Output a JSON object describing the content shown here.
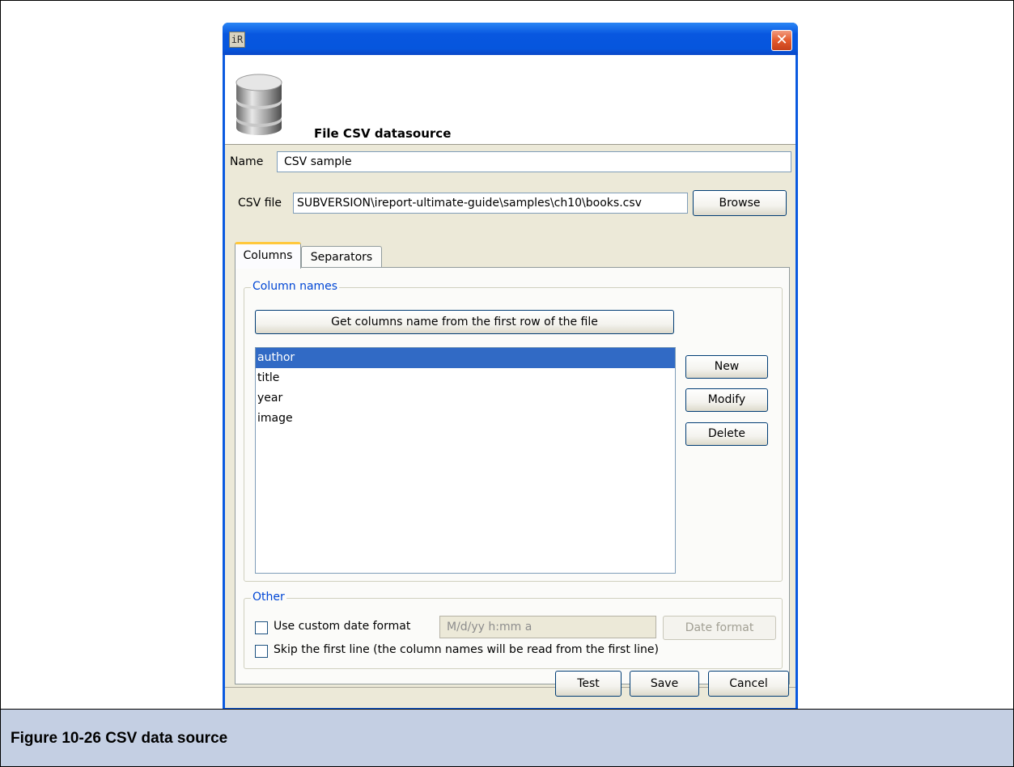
{
  "dialog": {
    "header_title": "File CSV datasource",
    "close_glyph": "✕",
    "app_icon": "iR"
  },
  "name_field": {
    "label": "Name",
    "value": "CSV sample"
  },
  "csv_file": {
    "label": "CSV file",
    "value": "SUBVERSION\\ireport-ultimate-guide\\samples\\ch10\\books.csv",
    "browse_label": "Browse"
  },
  "tabs": [
    {
      "label": "Columns",
      "active": true
    },
    {
      "label": "Separators",
      "active": false
    }
  ],
  "columns_group": {
    "legend": "Column names",
    "get_columns_label": "Get columns name from the first row of the file",
    "items": [
      "author",
      "title",
      "year",
      "image"
    ],
    "selected_index": 0,
    "new_label": "New",
    "modify_label": "Modify",
    "delete_label": "Delete"
  },
  "other_group": {
    "legend": "Other",
    "custom_date_label": "Use custom date format",
    "custom_date_checked": false,
    "date_format_value": "M/d/yy h:mm a",
    "date_format_button": "Date format",
    "skip_first_label": "Skip the first line (the column names will be read from the first line)",
    "skip_first_checked": false
  },
  "footer": {
    "test_label": "Test",
    "save_label": "Save",
    "cancel_label": "Cancel"
  },
  "caption": "Figure 10-26  CSV data source",
  "colors": {
    "title_bar": "#0a5ae0",
    "selection": "#316ac5",
    "legend": "#0046d5",
    "caption_bg": "#c4cfe3"
  }
}
